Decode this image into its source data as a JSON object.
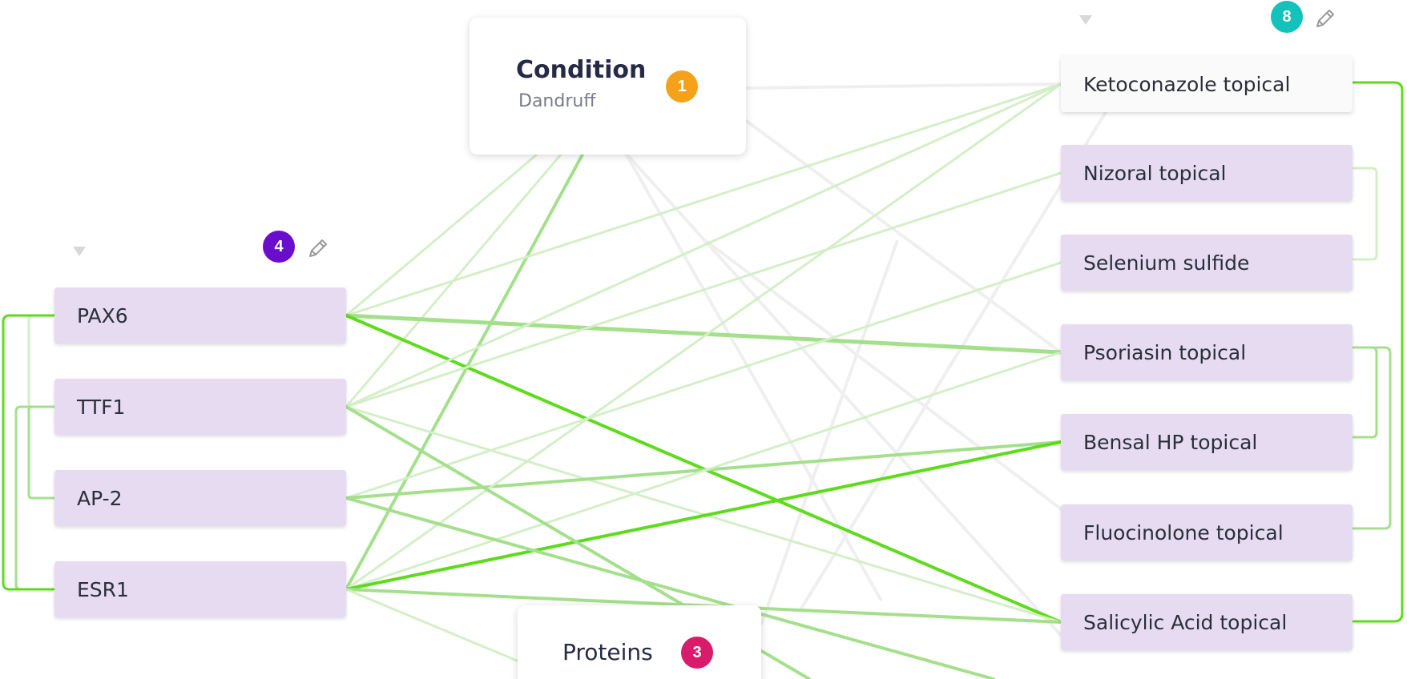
{
  "condition_card": {
    "title": "Condition",
    "subtitle": "Dandruff",
    "badge": "1",
    "badge_color": "#f5a21b"
  },
  "proteins_card": {
    "title": "Proteins",
    "badge": "3",
    "badge_color": "#d81b6a"
  },
  "protein_group": {
    "badge": "4",
    "badge_color": "#6a0dcc",
    "collapse_icon": "triangle-down-icon",
    "edit_icon": "pencil-icon",
    "items": [
      "PAX6",
      "TTF1",
      "AP-2",
      "ESR1"
    ]
  },
  "drug_group": {
    "badge": "8",
    "badge_color": "#12c2bb",
    "collapse_icon": "triangle-down-icon",
    "edit_icon": "pencil-icon",
    "items": [
      "Ketoconazole topical",
      "Nizoral topical",
      "Selenium sulfide",
      "Psoriasin topical",
      "Bensal HP topical",
      "Fluocinolone topical",
      "Salicylic Acid topical"
    ]
  },
  "colors": {
    "node_fill": "#e6dbf1",
    "selected_node_fill": "#fafafa",
    "edge_strong": "#5ddb1c",
    "edge_medium": "#a4e08c",
    "edge_light": "#d4efc7"
  }
}
